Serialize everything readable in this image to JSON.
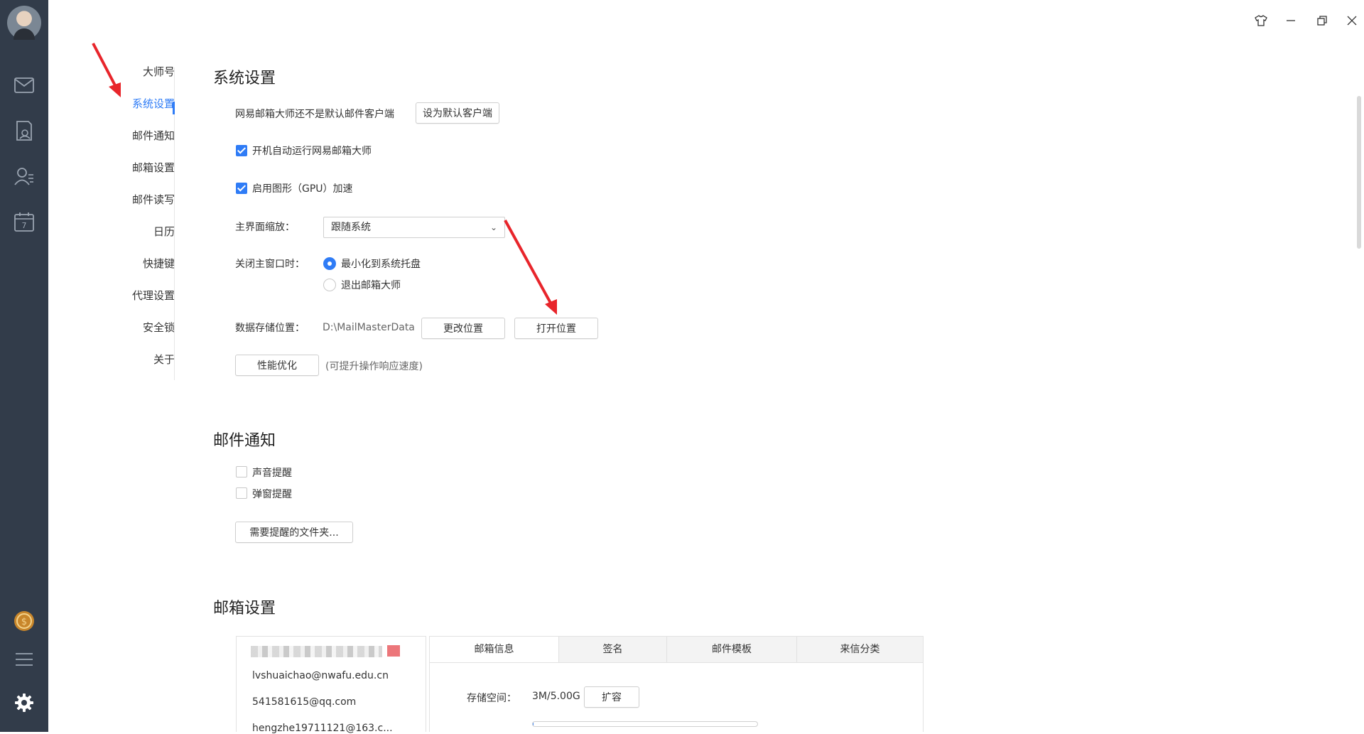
{
  "sidebar_rail": {
    "icons": [
      "mail-icon",
      "notes-icon",
      "contacts-icon",
      "calendar-icon"
    ],
    "calendar_day": "7",
    "coin_icon": "coin-icon",
    "menu_icon": "menu-icon",
    "settings_icon": "gear-icon"
  },
  "window_controls": [
    "skin-icon",
    "minimize-icon",
    "restore-icon",
    "close-icon"
  ],
  "settings_nav": {
    "items": [
      "大师号",
      "系统设置",
      "邮件通知",
      "邮箱设置",
      "邮件读写",
      "日历",
      "快捷键",
      "代理设置",
      "安全锁",
      "关于"
    ],
    "active": "系统设置"
  },
  "system_settings": {
    "title": "系统设置",
    "default_client_text": "网易邮箱大师还不是默认邮件客户端",
    "set_default_button": "设为默认客户端",
    "autostart_label": "开机自动运行网易邮箱大师",
    "autostart_checked": true,
    "gpu_label": "启用图形（GPU）加速",
    "gpu_checked": true,
    "zoom_label": "主界面缩放：",
    "zoom_value": "跟随系统",
    "close_label": "关闭主窗口时：",
    "close_options": [
      "最小化到系统托盘",
      "退出邮箱大师"
    ],
    "close_selected": "最小化到系统托盘",
    "storage_label": "数据存储位置：",
    "storage_path": "D:\\MailMasterData",
    "change_location_button": "更改位置",
    "open_location_button": "打开位置",
    "perf_button": "性能优化",
    "perf_hint": "(可提升操作响应速度)"
  },
  "mail_notify": {
    "title": "邮件通知",
    "sound_label": "声音提醒",
    "sound_checked": false,
    "popup_label": "弹窗提醒",
    "popup_checked": false,
    "folders_button": "需要提醒的文件夹..."
  },
  "mailbox_settings": {
    "title": "邮箱设置",
    "accounts": [
      "lvshuaichao@nwafu.edu.cn",
      "541581615@qq.com",
      "hengzhe19711121@163.c..."
    ],
    "tabs": [
      "邮箱信息",
      "签名",
      "邮件模板",
      "来信分类"
    ],
    "active_tab": "邮箱信息",
    "storage_label": "存储空间：",
    "storage_value": "3M/5.00G",
    "expand_button": "扩容",
    "storage_used_fraction": 0.0006
  },
  "annotation_color": "#e8252b",
  "accent_color": "#2f7cf6"
}
